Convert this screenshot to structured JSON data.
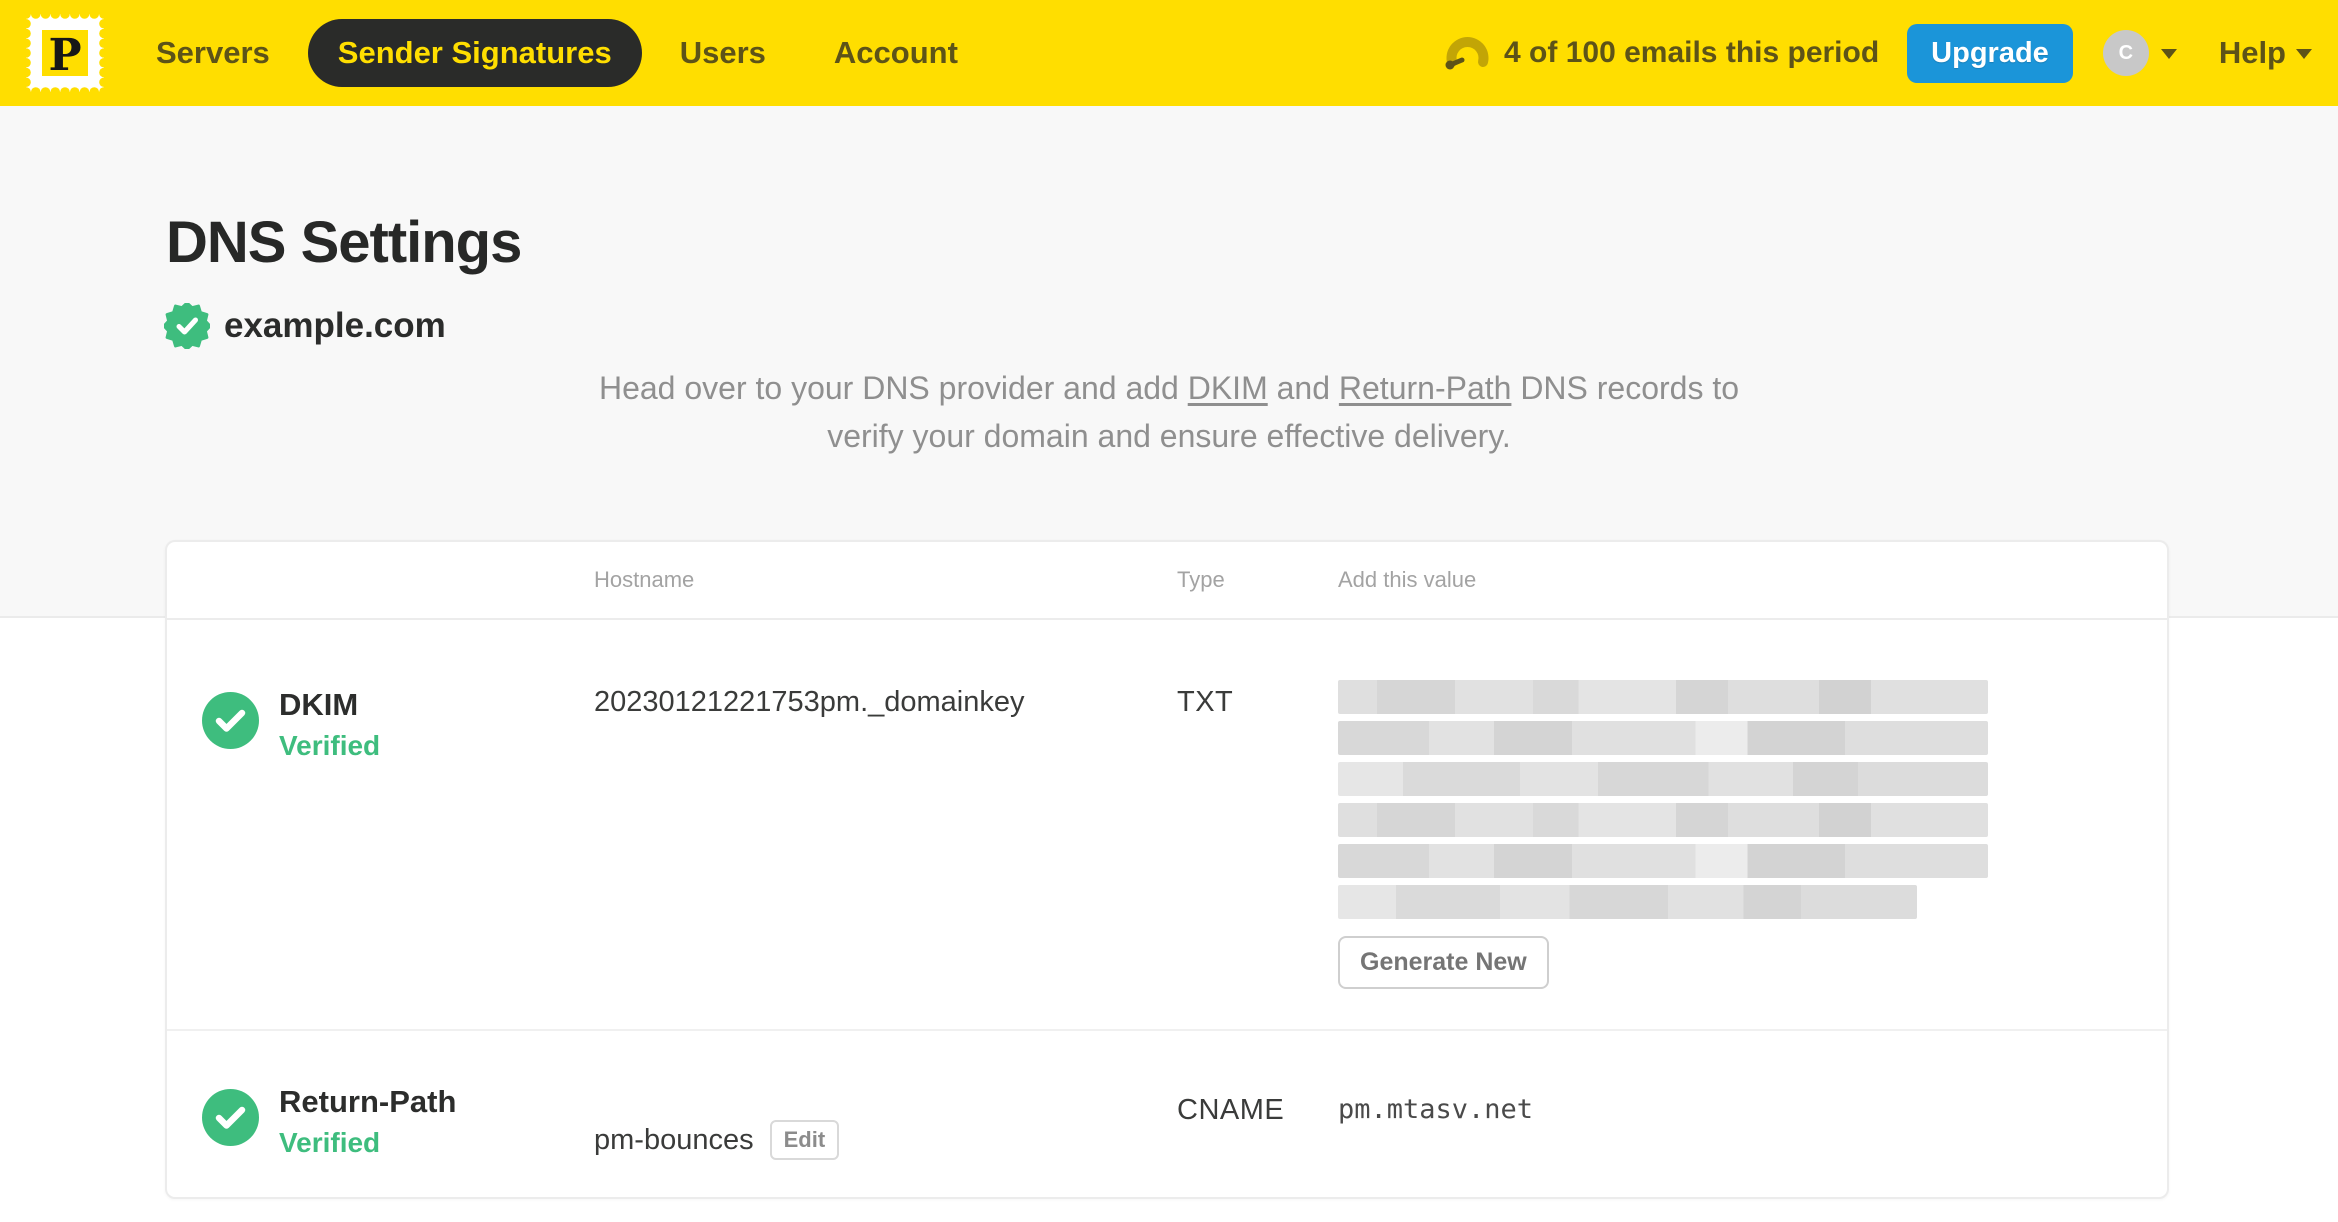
{
  "navbar": {
    "logo_letter": "P",
    "items": [
      {
        "label": "Servers",
        "active": false
      },
      {
        "label": "Sender Signatures",
        "active": true
      },
      {
        "label": "Users",
        "active": false
      },
      {
        "label": "Account",
        "active": false
      }
    ],
    "usage_text": "4 of 100 emails this period",
    "upgrade_label": "Upgrade",
    "avatar_initial": "C",
    "help_label": "Help"
  },
  "page": {
    "title": "DNS Settings",
    "domain": "example.com",
    "domain_verified": true,
    "description": {
      "part1": "Head over to your DNS provider and add ",
      "link_dkim": "DKIM",
      "part2": " and ",
      "link_return_path": "Return-Path",
      "part3": " DNS records to",
      "line2": "verify your domain and ensure effective delivery."
    }
  },
  "table": {
    "headers": {
      "hostname": "Hostname",
      "type": "Type",
      "value": "Add this value"
    },
    "rows": [
      {
        "name": "DKIM",
        "status": "Verified",
        "hostname": "20230121221753pm._domainkey",
        "type": "TXT",
        "value_redacted": true,
        "action_label": "Generate New"
      },
      {
        "name": "Return-Path",
        "status": "Verified",
        "hostname": "pm-bounces",
        "edit_label": "Edit",
        "type": "CNAME",
        "value": "pm.mtasv.net"
      }
    ]
  },
  "icons": {
    "logo": "postage-stamp-icon",
    "usage": "gauge-icon",
    "domain": "verified-seal-icon",
    "row_status": "check-circle-icon",
    "menus": "caret-down-icon"
  },
  "colors": {
    "brand_yellow": "#ffde00",
    "nav_text": "#5d5318",
    "active_pill_bg": "#2a2b29",
    "upgrade_blue": "#1b95d9",
    "verified_green": "#3ebd7e",
    "section_gray": "#f8f8f8"
  }
}
